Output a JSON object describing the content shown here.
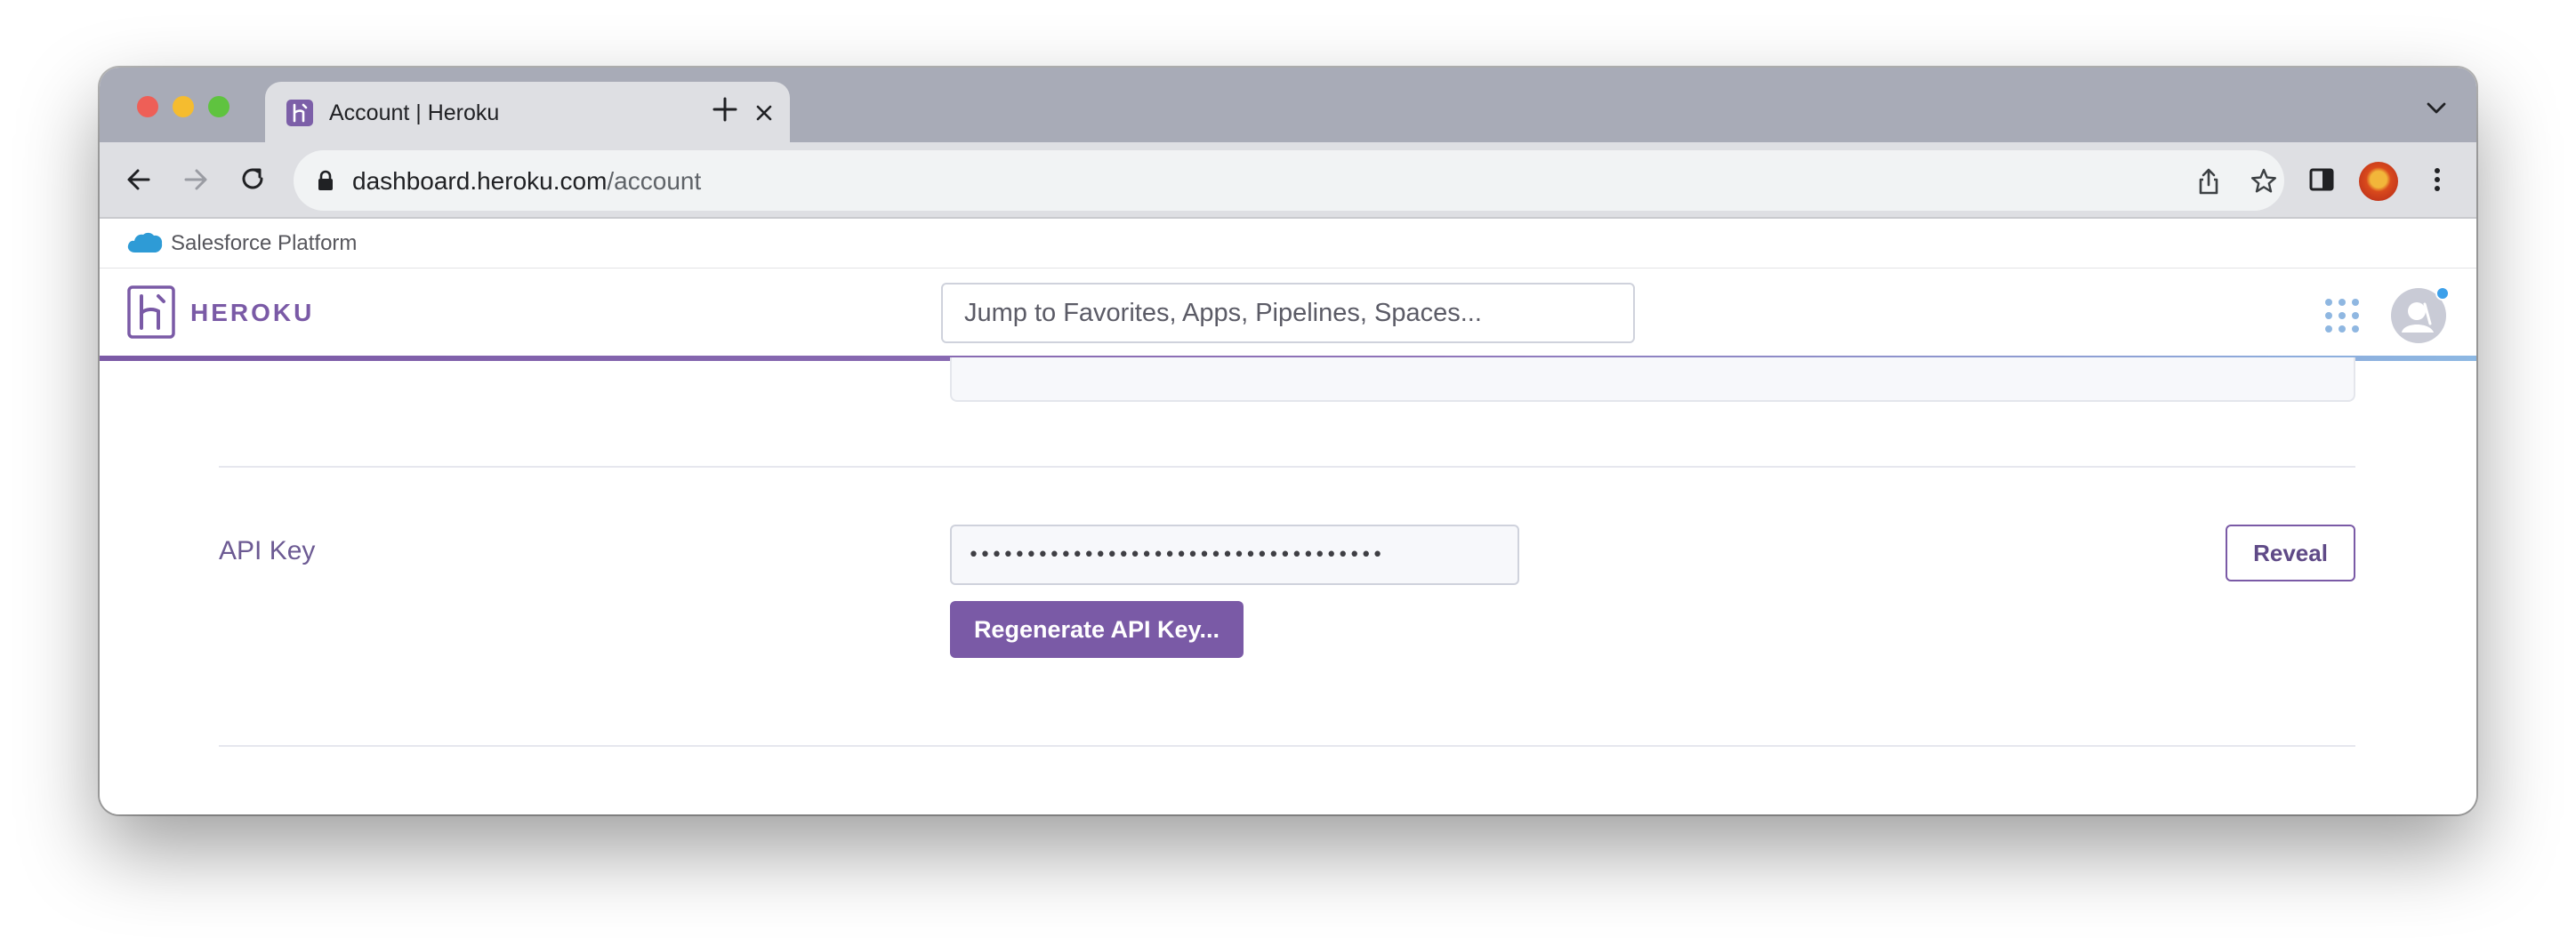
{
  "browser": {
    "tab": {
      "title": "Account | Heroku"
    },
    "url": {
      "domain": "dashboard.heroku.com",
      "path": "/account"
    }
  },
  "salesforce_bar": {
    "label": "Salesforce Platform"
  },
  "heroku_header": {
    "wordmark": "HEROKU",
    "search_placeholder": "Jump to Favorites, Apps, Pipelines, Spaces..."
  },
  "api_key_section": {
    "label": "API Key",
    "masked_value": "••••••••••••••••••••••••••••••••••••",
    "regenerate_label": "Regenerate API Key...",
    "reveal_label": "Reveal"
  },
  "colors": {
    "heroku_purple": "#7a5aa6",
    "tab_strip": "#a8abb7",
    "toolbar": "#dedfe3",
    "notification_dot": "#3da0ea"
  },
  "icons": {
    "tab_favicon": "heroku-favicon-icon",
    "salesforce": "salesforce-cloud-icon",
    "logo": "heroku-logo-icon",
    "apps": "apps-grid-icon",
    "avatar": "user-avatar-icon"
  }
}
